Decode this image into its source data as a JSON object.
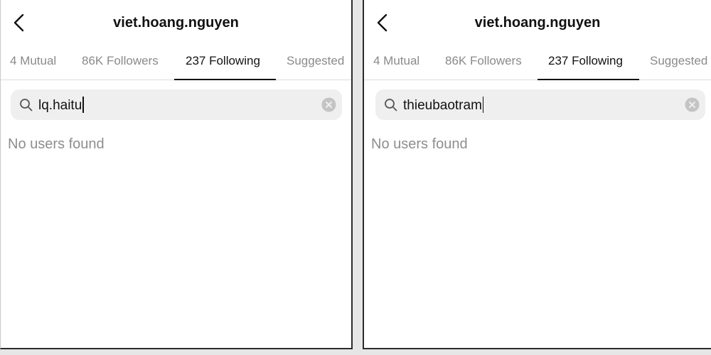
{
  "panels": [
    {
      "header": {
        "title": "viet.hoang.nguyen"
      },
      "tabs": [
        {
          "label": "4 Mutual"
        },
        {
          "label": "86K Followers"
        },
        {
          "label": "237 Following"
        },
        {
          "label": "Suggested"
        }
      ],
      "search": {
        "value": "lq.haitu"
      },
      "empty_message": "No users found"
    },
    {
      "header": {
        "title": "viet.hoang.nguyen"
      },
      "tabs": [
        {
          "label": "4 Mutual"
        },
        {
          "label": "86K Followers"
        },
        {
          "label": "237 Following"
        },
        {
          "label": "Suggested"
        }
      ],
      "search": {
        "value": "thieubaotram"
      },
      "empty_message": "No users found"
    }
  ],
  "active_tab": "237 Following",
  "icons": [
    "back-arrow-icon",
    "search-icon",
    "clear-icon"
  ],
  "colors": {
    "active_text": "#111111",
    "inactive_text": "#8a8a8a",
    "search_bg": "#efefef"
  }
}
